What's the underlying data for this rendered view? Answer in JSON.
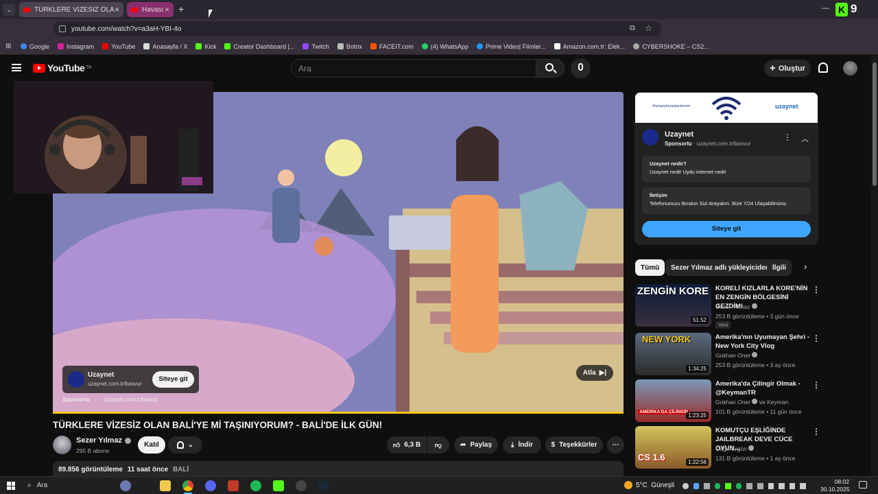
{
  "browser": {
    "tabs": [
      {
        "title": "TÜRKLERE VİZESİZ OLAN BALİ'Y",
        "active": true
      },
      {
        "title": "Havası",
        "active": false
      }
    ],
    "url": "youtube.com/watch?v=a3aH-YBI-4o",
    "profile_badge": "9",
    "bookmarks": [
      "Google",
      "Instagram",
      "YouTube",
      "Anasayfa / X",
      "Kick",
      "Creator Dashboard |...",
      "Twitch",
      "Botrix",
      "FACEIT.com",
      "(4) WhatsApp",
      "Prime Video| Filmler...",
      "Amazon.com.tr: Elek...",
      "CYBERSHOKE – CS2..."
    ]
  },
  "youtube": {
    "logo": "YouTube",
    "region": "TR",
    "search_placeholder": "Ara",
    "create_label": "Oluştur"
  },
  "player": {
    "ad_card": {
      "name": "Uzaynet",
      "url": "uzaynet.com.tr/basvur",
      "cta": "Siteye git"
    },
    "sponsored": "Sponsorlu",
    "sponsored_url": "uzaynet.com.tr/basvur",
    "skip_label": "Atla"
  },
  "video": {
    "title": "TÜRKLERE VİZESİZ OLAN BALİ'YE Mİ TAŞINIYORUM? - BALİ'DE İLK GÜN!",
    "channel": "Sezer Yılmaz",
    "subscribers": "295 B abone",
    "join_label": "Katıl",
    "likes": "6,3 B",
    "share_label": "Paylaş",
    "download_label": "İndir",
    "thanks_label": "Teşekkürler",
    "views": "89.856 görüntüleme",
    "age": "11 saat önce",
    "tag": "BALİ"
  },
  "side_ad": {
    "banner_tagline": "#herşeyburadainternet",
    "banner_logo": "uzaynet",
    "name": "Uzaynet",
    "sponsored": "Sponsorlu",
    "url": "uzaynet.com.tr/basvur",
    "faq": [
      {
        "q": "Uzaynet nedir?",
        "a": "Uzaynet nedir Uydu internet nedir"
      },
      {
        "q": "İletişim",
        "a": "Telefonunuzu Bırakın Sizi Arayalım. Bize 7/24 Ulaşabilirsiniz."
      }
    ],
    "cta": "Siteye git"
  },
  "chips": [
    "Tümü",
    "Sezer Yılmaz adlı yükleyiciden",
    "İlgili"
  ],
  "recommendations": [
    {
      "title": "KORELİ KIZLARLA KORE'NİN EN ZENGİN BÖLGESİNİ GEZDİM!",
      "channel": "Sezer Yılmaz",
      "meta": "253 B görüntüleme • 3 gün önce",
      "badge": "Yeni",
      "duration": "51:52",
      "thumb_text": "ZENGİN KORE"
    },
    {
      "title": "Amerika'nın Uyumayan Şehri - New York City Vlog",
      "channel": "Gokhan Oner",
      "meta": "253 B görüntüleme • 3 ay önce",
      "badge": "",
      "duration": "1:34:25",
      "thumb_text": "NEW YORK"
    },
    {
      "title": "Amerika'da Çilingir Olmak - @KeymanTR",
      "channel": "Gokhan Oner",
      "channel_suffix": "ve Keyman",
      "meta": "101 B görüntüleme • 11 gün önce",
      "badge": "",
      "duration": "1:23:25",
      "thumb_text": "AMERİKA'DA ÇİLİNGİR"
    },
    {
      "title": "KOMUTÇU EŞLİĞİNDE JAILBREAK DEVE CÜCE OYUN...",
      "channel": "Çağrı Ergün",
      "meta": "131 B görüntüleme • 1 ay önce",
      "badge": "",
      "duration": "1:22:56",
      "thumb_text": "CS 1.6"
    }
  ],
  "taskbar": {
    "search": "Ara",
    "weather": "5°C  Güneşli",
    "time": "08:02",
    "date": "30.10.2025"
  }
}
